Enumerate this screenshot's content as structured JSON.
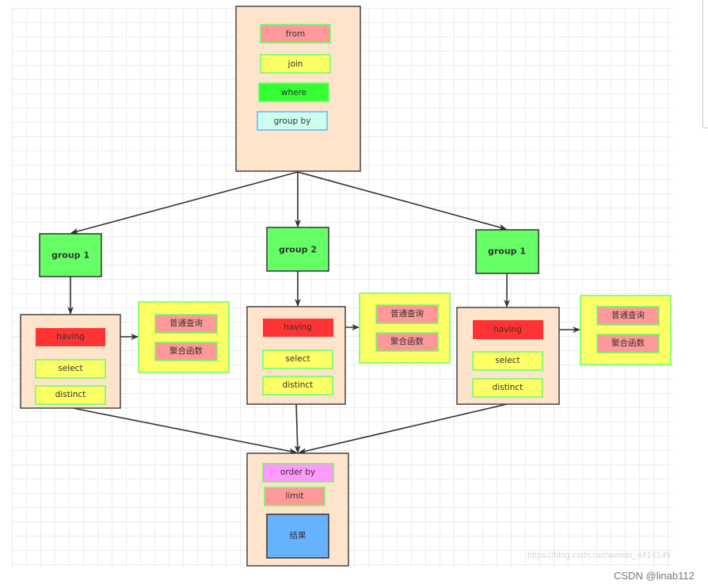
{
  "top_box": {
    "items": [
      "from",
      "join",
      "where",
      "group by"
    ]
  },
  "groups": [
    {
      "label": "group 1",
      "having": "having",
      "select": "select",
      "distinct": "distinct",
      "side": [
        "普通查询",
        "聚合函数"
      ]
    },
    {
      "label": "group 2",
      "having": "having",
      "select": "select",
      "distinct": "distinct",
      "side": [
        "普通查询",
        "聚合函数"
      ]
    },
    {
      "label": "group 1",
      "having": "having",
      "select": "select",
      "distinct": "distinct",
      "side": [
        "普通查询",
        "聚合函数"
      ]
    }
  ],
  "bottom_box": {
    "order_by": "order by",
    "limit": "limit",
    "result": "结果"
  },
  "watermark": "https://blog.csdn.net/weixin_4414149",
  "credit": "CSDN @linab112",
  "colors": {
    "container": "#ffe4cc",
    "group": "#66ff66",
    "from": "#ff9999",
    "join": "#ffff66",
    "where": "#33ff33",
    "group_by": "#ccffee",
    "having": "#ff3333",
    "order_by": "#ff99ff",
    "result": "#66b2ff"
  }
}
